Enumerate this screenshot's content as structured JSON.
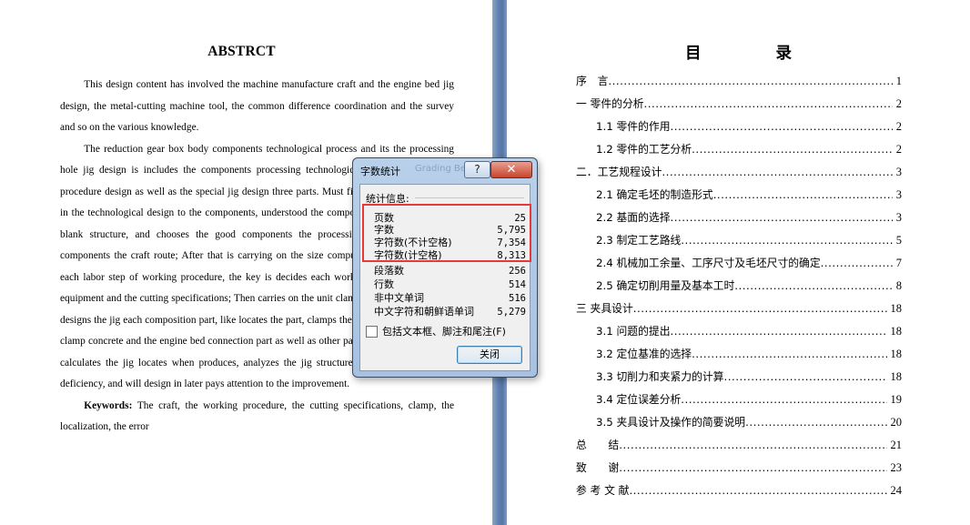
{
  "left_page": {
    "title": "ABSTRCT",
    "paragraph1": "This design content has involved the machine manufacture craft and the engine bed jig design, the metal-cutting machine tool, the common difference coordination and the survey and so on the various knowledge.",
    "paragraph2": "The reduction gear box body components technological process and its the processing hole jig design is includes the components processing technological design, the working procedure design as well as the special jig design three parts. Must first carry on the analysis in the technological design to the components, understood the components the craft redesign blank structure, and chooses the good components the processing datum, designs the components the craft route; After that is carrying on the size computation to a components each labor step of working procedure, the key is decides each working procedure the craft equipment and the cutting specifications; Then carries on the unit clamp the design, the choice designs the jig each composition part, like locates the part, clamps the part, guidance part, unit clamp concrete and the engine bed connection part as well as other parts; Position error which calculates the jig locates when produces, analyzes the jig structure the rationality and the deficiency, and will design in later pays attention to the improvement.",
    "keywords_label": "Keywords:",
    "keywords_text": " The craft, the working procedure, the cutting specifications, clamp, the localization, the error"
  },
  "right_page": {
    "toc_title": "目 录",
    "entries": [
      {
        "label": "序　言",
        "page": "1",
        "indent": false
      },
      {
        "label": "一 零件的分析",
        "page": "2",
        "indent": false
      },
      {
        "label": "1.1 零件的作用",
        "page": "2",
        "indent": true
      },
      {
        "label": "1.2 零件的工艺分析",
        "page": "2",
        "indent": true
      },
      {
        "label": "二．工艺规程设计",
        "page": "3",
        "indent": false
      },
      {
        "label": "2.1 确定毛坯的制造形式",
        "page": "3",
        "indent": true
      },
      {
        "label": "2.2 基面的选择",
        "page": "3",
        "indent": true
      },
      {
        "label": "2.3 制定工艺路线",
        "page": "5",
        "indent": true
      },
      {
        "label": "2.4 机械加工余量、工序尺寸及毛坯尺寸的确定",
        "page": "7",
        "indent": true
      },
      {
        "label": "2.5 确定切削用量及基本工时",
        "page": "8",
        "indent": true
      },
      {
        "label": "三 夹具设计",
        "page": "18",
        "indent": false
      },
      {
        "label": "3.1 问题的提出",
        "page": "18",
        "indent": true
      },
      {
        "label": "3.2 定位基准的选择",
        "page": "18",
        "indent": true
      },
      {
        "label": "3.3 切削力和夹紧力的计算",
        "page": "18",
        "indent": true
      },
      {
        "label": "3.4 定位误差分析",
        "page": "19",
        "indent": true
      },
      {
        "label": "3.5 夹具设计及操作的简要说明",
        "page": "20",
        "indent": true
      },
      {
        "label": "总　　结",
        "page": "21",
        "indent": false
      },
      {
        "label": "致　　谢",
        "page": "23",
        "indent": false
      },
      {
        "label": "参 考 文 献",
        "page": "24",
        "indent": false
      }
    ]
  },
  "dialog": {
    "title": "字数统计",
    "ghost_text": "Grading Be",
    "help_label": "?",
    "close_icon": "✕",
    "stats_header": "统计信息:",
    "stats": [
      {
        "label": "页数",
        "value": "25"
      },
      {
        "label": "字数",
        "value": "5,795"
      },
      {
        "label": "字符数(不计空格)",
        "value": "7,354"
      },
      {
        "label": "字符数(计空格)",
        "value": "8,313"
      },
      {
        "label": "段落数",
        "value": "256"
      },
      {
        "label": "行数",
        "value": "514"
      },
      {
        "label": "非中文单词",
        "value": "516"
      },
      {
        "label": "中文字符和朝鲜语单词",
        "value": "5,279"
      }
    ],
    "checkbox_label": "包括文本框、脚注和尾注(F)",
    "checkbox_checked": false,
    "close_button_label": "关闭",
    "highlight_color": "#e8393a"
  }
}
